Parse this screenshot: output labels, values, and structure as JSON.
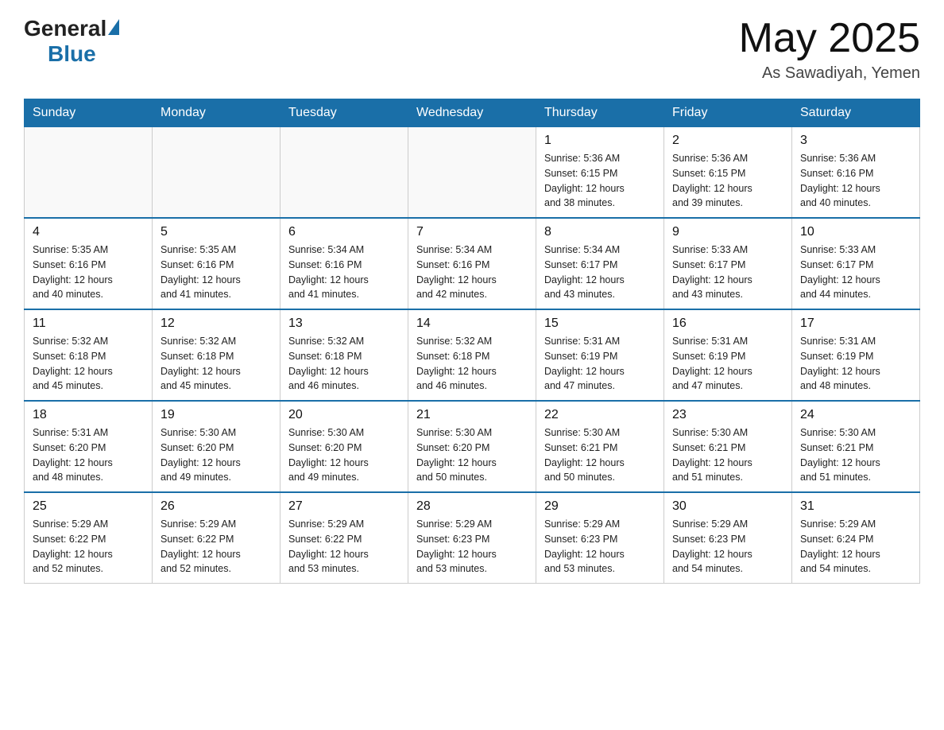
{
  "logo": {
    "text_general": "General",
    "text_blue": "Blue"
  },
  "header": {
    "month_year": "May 2025",
    "location": "As Sawadiyah, Yemen"
  },
  "weekdays": [
    "Sunday",
    "Monday",
    "Tuesday",
    "Wednesday",
    "Thursday",
    "Friday",
    "Saturday"
  ],
  "weeks": [
    [
      {
        "day": "",
        "info": ""
      },
      {
        "day": "",
        "info": ""
      },
      {
        "day": "",
        "info": ""
      },
      {
        "day": "",
        "info": ""
      },
      {
        "day": "1",
        "info": "Sunrise: 5:36 AM\nSunset: 6:15 PM\nDaylight: 12 hours\nand 38 minutes."
      },
      {
        "day": "2",
        "info": "Sunrise: 5:36 AM\nSunset: 6:15 PM\nDaylight: 12 hours\nand 39 minutes."
      },
      {
        "day": "3",
        "info": "Sunrise: 5:36 AM\nSunset: 6:16 PM\nDaylight: 12 hours\nand 40 minutes."
      }
    ],
    [
      {
        "day": "4",
        "info": "Sunrise: 5:35 AM\nSunset: 6:16 PM\nDaylight: 12 hours\nand 40 minutes."
      },
      {
        "day": "5",
        "info": "Sunrise: 5:35 AM\nSunset: 6:16 PM\nDaylight: 12 hours\nand 41 minutes."
      },
      {
        "day": "6",
        "info": "Sunrise: 5:34 AM\nSunset: 6:16 PM\nDaylight: 12 hours\nand 41 minutes."
      },
      {
        "day": "7",
        "info": "Sunrise: 5:34 AM\nSunset: 6:16 PM\nDaylight: 12 hours\nand 42 minutes."
      },
      {
        "day": "8",
        "info": "Sunrise: 5:34 AM\nSunset: 6:17 PM\nDaylight: 12 hours\nand 43 minutes."
      },
      {
        "day": "9",
        "info": "Sunrise: 5:33 AM\nSunset: 6:17 PM\nDaylight: 12 hours\nand 43 minutes."
      },
      {
        "day": "10",
        "info": "Sunrise: 5:33 AM\nSunset: 6:17 PM\nDaylight: 12 hours\nand 44 minutes."
      }
    ],
    [
      {
        "day": "11",
        "info": "Sunrise: 5:32 AM\nSunset: 6:18 PM\nDaylight: 12 hours\nand 45 minutes."
      },
      {
        "day": "12",
        "info": "Sunrise: 5:32 AM\nSunset: 6:18 PM\nDaylight: 12 hours\nand 45 minutes."
      },
      {
        "day": "13",
        "info": "Sunrise: 5:32 AM\nSunset: 6:18 PM\nDaylight: 12 hours\nand 46 minutes."
      },
      {
        "day": "14",
        "info": "Sunrise: 5:32 AM\nSunset: 6:18 PM\nDaylight: 12 hours\nand 46 minutes."
      },
      {
        "day": "15",
        "info": "Sunrise: 5:31 AM\nSunset: 6:19 PM\nDaylight: 12 hours\nand 47 minutes."
      },
      {
        "day": "16",
        "info": "Sunrise: 5:31 AM\nSunset: 6:19 PM\nDaylight: 12 hours\nand 47 minutes."
      },
      {
        "day": "17",
        "info": "Sunrise: 5:31 AM\nSunset: 6:19 PM\nDaylight: 12 hours\nand 48 minutes."
      }
    ],
    [
      {
        "day": "18",
        "info": "Sunrise: 5:31 AM\nSunset: 6:20 PM\nDaylight: 12 hours\nand 48 minutes."
      },
      {
        "day": "19",
        "info": "Sunrise: 5:30 AM\nSunset: 6:20 PM\nDaylight: 12 hours\nand 49 minutes."
      },
      {
        "day": "20",
        "info": "Sunrise: 5:30 AM\nSunset: 6:20 PM\nDaylight: 12 hours\nand 49 minutes."
      },
      {
        "day": "21",
        "info": "Sunrise: 5:30 AM\nSunset: 6:20 PM\nDaylight: 12 hours\nand 50 minutes."
      },
      {
        "day": "22",
        "info": "Sunrise: 5:30 AM\nSunset: 6:21 PM\nDaylight: 12 hours\nand 50 minutes."
      },
      {
        "day": "23",
        "info": "Sunrise: 5:30 AM\nSunset: 6:21 PM\nDaylight: 12 hours\nand 51 minutes."
      },
      {
        "day": "24",
        "info": "Sunrise: 5:30 AM\nSunset: 6:21 PM\nDaylight: 12 hours\nand 51 minutes."
      }
    ],
    [
      {
        "day": "25",
        "info": "Sunrise: 5:29 AM\nSunset: 6:22 PM\nDaylight: 12 hours\nand 52 minutes."
      },
      {
        "day": "26",
        "info": "Sunrise: 5:29 AM\nSunset: 6:22 PM\nDaylight: 12 hours\nand 52 minutes."
      },
      {
        "day": "27",
        "info": "Sunrise: 5:29 AM\nSunset: 6:22 PM\nDaylight: 12 hours\nand 53 minutes."
      },
      {
        "day": "28",
        "info": "Sunrise: 5:29 AM\nSunset: 6:23 PM\nDaylight: 12 hours\nand 53 minutes."
      },
      {
        "day": "29",
        "info": "Sunrise: 5:29 AM\nSunset: 6:23 PM\nDaylight: 12 hours\nand 53 minutes."
      },
      {
        "day": "30",
        "info": "Sunrise: 5:29 AM\nSunset: 6:23 PM\nDaylight: 12 hours\nand 54 minutes."
      },
      {
        "day": "31",
        "info": "Sunrise: 5:29 AM\nSunset: 6:24 PM\nDaylight: 12 hours\nand 54 minutes."
      }
    ]
  ]
}
